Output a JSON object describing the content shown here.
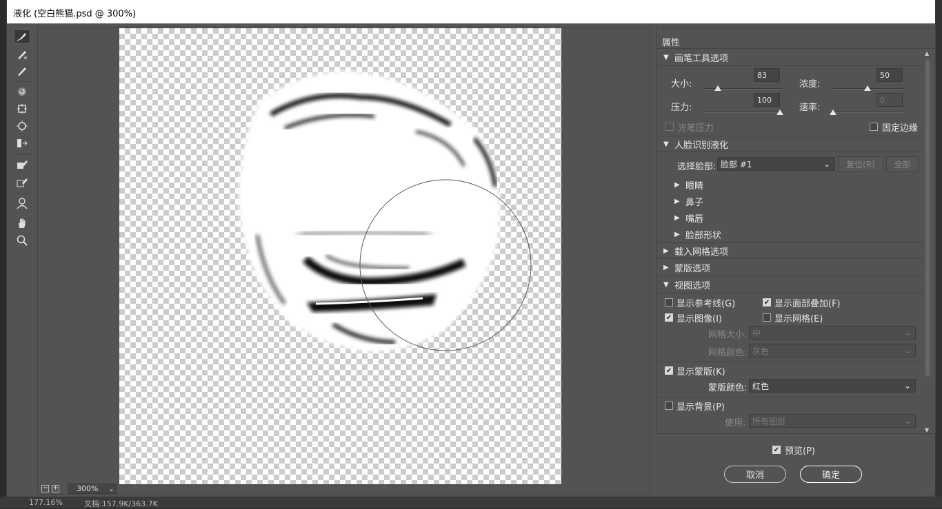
{
  "window": {
    "title": "液化 (空白熊猫.psd @ 300%)"
  },
  "tools": [
    {
      "name": "forward-warp-tool",
      "active": true
    },
    {
      "name": "reconstruct-tool"
    },
    {
      "name": "smooth-tool"
    },
    {
      "name": "twirl-clockwise-tool"
    },
    {
      "name": "pucker-tool"
    },
    {
      "name": "bloat-tool"
    },
    {
      "name": "push-left-tool"
    },
    {
      "name": "freeze-mask-tool"
    },
    {
      "name": "thaw-mask-tool"
    },
    {
      "name": "face-tool"
    },
    {
      "name": "hand-tool"
    },
    {
      "name": "zoom-tool"
    }
  ],
  "canvas": {
    "zoom": "300%"
  },
  "properties": {
    "title": "属性",
    "brush": {
      "header": "画笔工具选项",
      "size_label": "大小:",
      "size": "83",
      "density_label": "浓度:",
      "density": "50",
      "pressure_label": "压力:",
      "pressure": "100",
      "rate_label": "速率:",
      "rate": "0",
      "stylus_label": "光笔压力",
      "pin_edges_label": "固定边缘"
    },
    "face": {
      "header": "人脸识别液化",
      "select_label": "选择脸部:",
      "select_value": "脸部 #1",
      "reset_label": "复位(R)",
      "all_label": "全部",
      "items": [
        "眼睛",
        "鼻子",
        "嘴唇",
        "脸部形状"
      ]
    },
    "load_mesh": {
      "header": "载入网格选项"
    },
    "mask": {
      "header": "蒙版选项"
    },
    "view": {
      "header": "视图选项",
      "show_guides": "显示参考线(G)",
      "show_face_overlay": "显示面部叠加(F)",
      "show_image": "显示图像(I)",
      "show_mesh": "显示网格(E)",
      "mesh_size_label": "网格大小:",
      "mesh_size": "中",
      "mesh_color_label": "网格颜色:",
      "mesh_color": "灰色",
      "show_mask": "显示蒙版(K)",
      "mask_color_label": "蒙版颜色:",
      "mask_color": "红色",
      "show_backdrop": "显示背景(P)",
      "use_label": "使用:",
      "use_value": "所有图层"
    }
  },
  "footer": {
    "preview_label": "预览(P)",
    "cancel_label": "取消",
    "ok_label": "确定"
  },
  "status": {
    "zoom": "177.16%",
    "doc": "文档:157.9K/363.7K"
  }
}
